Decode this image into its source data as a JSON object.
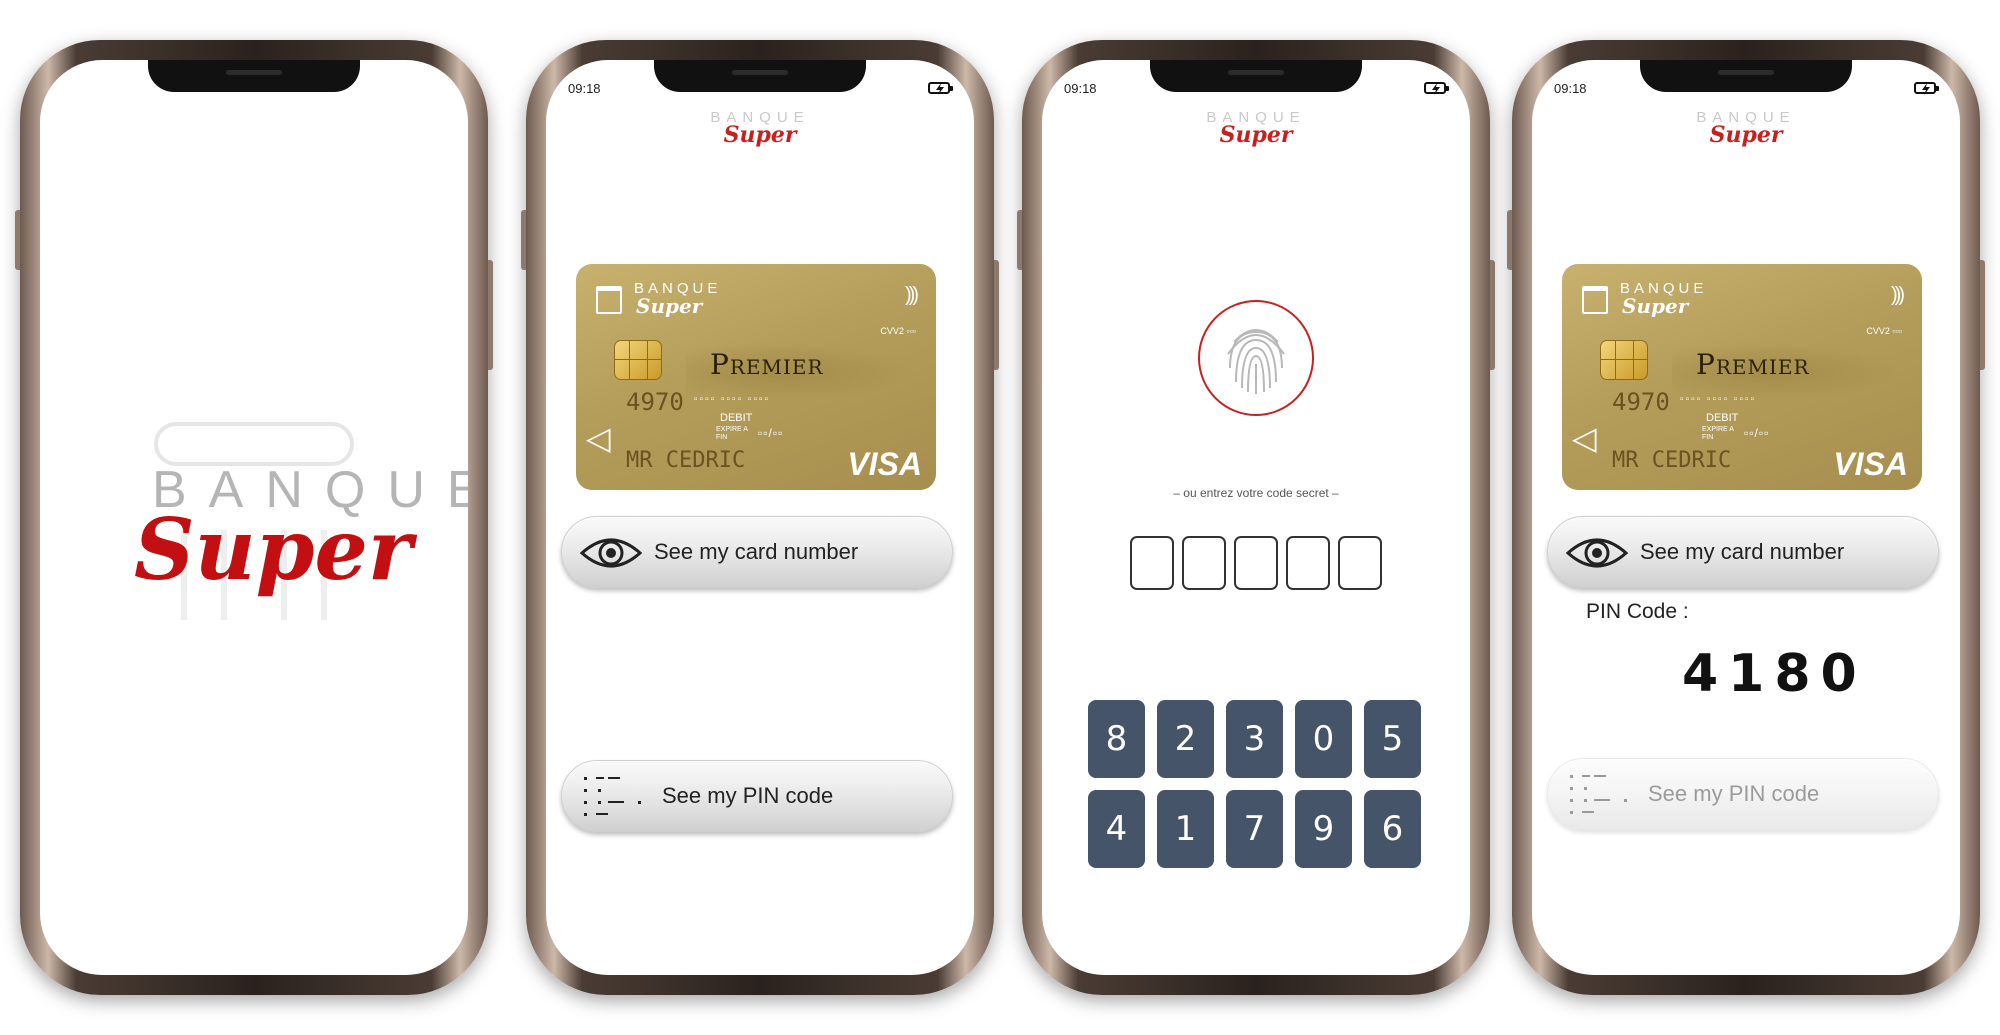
{
  "screens": [
    {
      "name": "splash",
      "logo_top": "BANQUE",
      "logo_script": "Super"
    },
    {
      "name": "card",
      "time": "09:18",
      "logo_top": "BANQUE",
      "logo_script": "Super",
      "card": {
        "brand_top": "BANQUE",
        "brand_script": "Super",
        "product": "Premier",
        "number_prefix": "4970",
        "masked_groups": "▫▫▫▫ ▫▫▫▫ ▫▫▫▫",
        "cvv_label": "CVV2 ▫▫▫",
        "type": "DEBIT",
        "expire_label": "EXPIRE A FIN",
        "expire_value": "▫▫/▫▫",
        "holder": "MR CEDRIC",
        "network": "VISA"
      },
      "buttons": {
        "card_number": "See my card number",
        "pin_code": "See my PIN code"
      }
    },
    {
      "name": "auth",
      "time": "09:18",
      "logo_top": "BANQUE",
      "logo_script": "Super",
      "hint": "– ou entrez votre code secret –",
      "keypad": [
        "8",
        "2",
        "3",
        "0",
        "5",
        "4",
        "1",
        "7",
        "9",
        "6"
      ]
    },
    {
      "name": "pin",
      "time": "09:18",
      "logo_top": "BANQUE",
      "logo_script": "Super",
      "card": {
        "brand_top": "BANQUE",
        "brand_script": "Super",
        "product": "Premier",
        "number_prefix": "4970",
        "masked_groups": "▫▫▫▫ ▫▫▫▫ ▫▫▫▫",
        "cvv_label": "CVV2 ▫▫▫",
        "type": "DEBIT",
        "expire_label": "EXPIRE A FIN",
        "expire_value": "▫▫/▫▫",
        "holder": "MR CEDRIC",
        "network": "VISA"
      },
      "buttons": {
        "card_number": "See my card number",
        "pin_code": "See my PIN code"
      },
      "pin_label": "PIN Code :",
      "pin_value": "4180"
    }
  ],
  "colors": {
    "brand_red": "#c81f1f",
    "key_bg": "#455468",
    "card_gold": "#b49d5a"
  },
  "icons": [
    "battery-charging-icon",
    "eye-icon",
    "dotted-grid-icon",
    "fingerprint-icon",
    "contactless-icon",
    "chip-icon"
  ]
}
